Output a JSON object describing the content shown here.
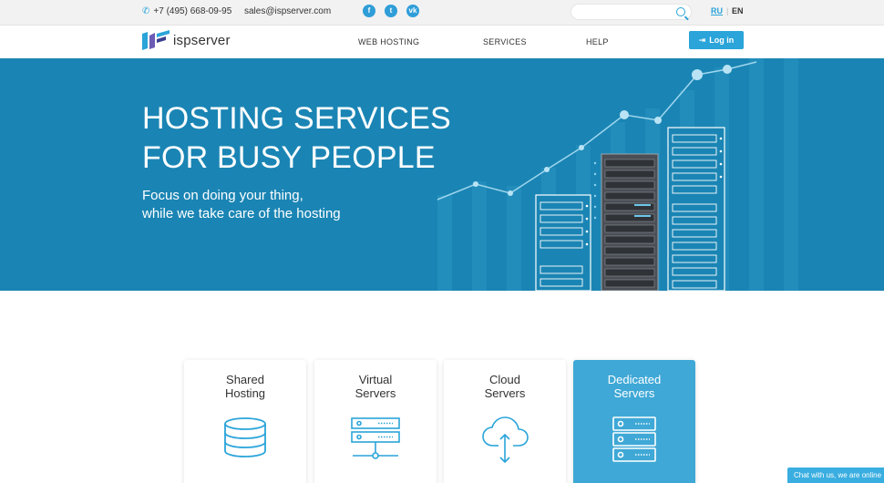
{
  "topbar": {
    "phone": "+7 (495) 668-09-95",
    "email": "sales@ispserver.com",
    "social": [
      "f",
      "t",
      "vk"
    ],
    "search_placeholder": "",
    "lang_ru": "RU",
    "lang_sep": "|",
    "lang_en": "EN"
  },
  "header": {
    "logo_text": "ispserver",
    "nav": [
      "WEB HOSTING",
      "SERVICES",
      "HELP"
    ],
    "login_label": "Log in"
  },
  "hero": {
    "title_line1": "HOSTING SERVICES",
    "title_line2": "FOR BUSY PEOPLE",
    "subtitle_line1": "Focus on doing your thing,",
    "subtitle_line2": "while we take care of the hosting"
  },
  "cards": [
    {
      "title_line1": "Shared",
      "title_line2": "Hosting",
      "icon": "database-icon",
      "price": ""
    },
    {
      "title_line1": "Virtual",
      "title_line2": "Servers",
      "icon": "server-network-icon",
      "price": ""
    },
    {
      "title_line1": "Cloud",
      "title_line2": "Servers",
      "icon": "cloud-upload-download-icon",
      "price": ""
    },
    {
      "title_line1": "Dedicated",
      "title_line2": "Servers",
      "icon": "server-rack-icon",
      "price": ""
    }
  ],
  "chat": {
    "label": "Chat with us, we are online"
  },
  "colors": {
    "accent": "#2aa4d9",
    "hero_bg": "#1a85b4",
    "active_card": "#3fa8d6"
  }
}
